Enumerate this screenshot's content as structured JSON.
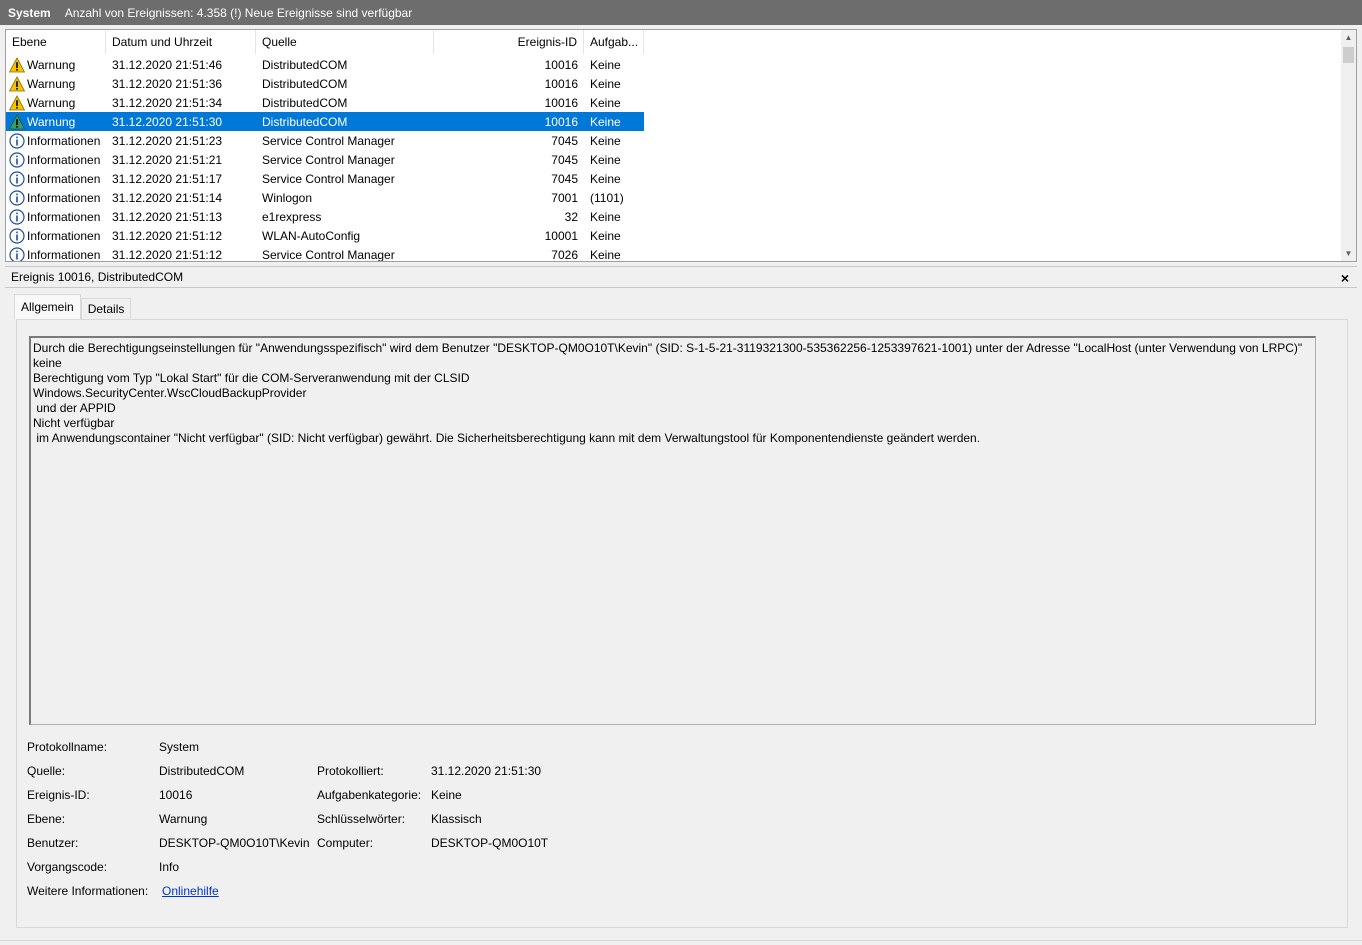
{
  "titlebar": {
    "app": "System",
    "info": "Anzahl von Ereignissen: 4.358 (!) Neue Ereignisse sind verfügbar"
  },
  "list": {
    "columns": {
      "level": "Ebene",
      "date": "Datum und Uhrzeit",
      "source": "Quelle",
      "id": "Ereignis-ID",
      "task": "Aufgab..."
    },
    "rows": [
      {
        "icon": "warning-icon",
        "level": "Warnung",
        "date": "31.12.2020 21:51:46",
        "source": "DistributedCOM",
        "id": "10016",
        "task": "Keine"
      },
      {
        "icon": "warning-icon",
        "level": "Warnung",
        "date": "31.12.2020 21:51:36",
        "source": "DistributedCOM",
        "id": "10016",
        "task": "Keine"
      },
      {
        "icon": "warning-icon",
        "level": "Warnung",
        "date": "31.12.2020 21:51:34",
        "source": "DistributedCOM",
        "id": "10016",
        "task": "Keine"
      },
      {
        "icon": "warning-icon",
        "level": "Warnung",
        "date": "31.12.2020 21:51:30",
        "source": "DistributedCOM",
        "id": "10016",
        "task": "Keine",
        "selected": true
      },
      {
        "icon": "info-icon",
        "level": "Informationen",
        "date": "31.12.2020 21:51:23",
        "source": "Service Control Manager",
        "id": "7045",
        "task": "Keine"
      },
      {
        "icon": "info-icon",
        "level": "Informationen",
        "date": "31.12.2020 21:51:21",
        "source": "Service Control Manager",
        "id": "7045",
        "task": "Keine"
      },
      {
        "icon": "info-icon",
        "level": "Informationen",
        "date": "31.12.2020 21:51:17",
        "source": "Service Control Manager",
        "id": "7045",
        "task": "Keine"
      },
      {
        "icon": "info-icon",
        "level": "Informationen",
        "date": "31.12.2020 21:51:14",
        "source": "Winlogon",
        "id": "7001",
        "task": "(1101)"
      },
      {
        "icon": "info-icon",
        "level": "Informationen",
        "date": "31.12.2020 21:51:13",
        "source": "e1rexpress",
        "id": "32",
        "task": "Keine"
      },
      {
        "icon": "info-icon",
        "level": "Informationen",
        "date": "31.12.2020 21:51:12",
        "source": "WLAN-AutoConfig",
        "id": "10001",
        "task": "Keine"
      },
      {
        "icon": "info-icon",
        "level": "Informationen",
        "date": "31.12.2020 21:51:12",
        "source": "Service Control Manager",
        "id": "7026",
        "task": "Keine"
      }
    ]
  },
  "detail": {
    "title": "Ereignis 10016, DistributedCOM",
    "close": "×",
    "tabs": {
      "general": "Allgemein",
      "details": "Details"
    },
    "description": "Durch die Berechtigungseinstellungen für \"Anwendungsspezifisch\" wird dem Benutzer \"DESKTOP-QM0O10T\\Kevin\" (SID: S-1-5-21-3119321300-535362256-1253397621-1001) unter der Adresse \"LocalHost (unter Verwendung von LRPC)\" keine\nBerechtigung vom Typ \"Lokal Start\" für die COM-Serveranwendung mit der CLSID\nWindows.SecurityCenter.WscCloudBackupProvider\n und der APPID\nNicht verfügbar\n im Anwendungscontainer \"Nicht verfügbar\" (SID: Nicht verfügbar) gewährt. Die Sicherheitsberechtigung kann mit dem Verwaltungstool für Komponentendienste geändert werden.",
    "props": {
      "logname_label": "Protokollname:",
      "logname": "System",
      "source_label": "Quelle:",
      "source": "DistributedCOM",
      "logged_label": "Protokolliert:",
      "logged": "31.12.2020 21:51:30",
      "eventid_label": "Ereignis-ID:",
      "eventid": "10016",
      "taskcat_label": "Aufgabenkategorie:",
      "taskcat": "Keine",
      "level_label": "Ebene:",
      "level": "Warnung",
      "keywords_label": "Schlüsselwörter:",
      "keywords": "Klassisch",
      "user_label": "Benutzer:",
      "user": "DESKTOP-QM0O10T\\Kevin",
      "computer_label": "Computer:",
      "computer": "DESKTOP-QM0O10T",
      "opcode_label": "Vorgangscode:",
      "opcode": "Info",
      "moreinfo_label": "Weitere Informationen:",
      "moreinfo": "Onlinehilfe"
    }
  }
}
